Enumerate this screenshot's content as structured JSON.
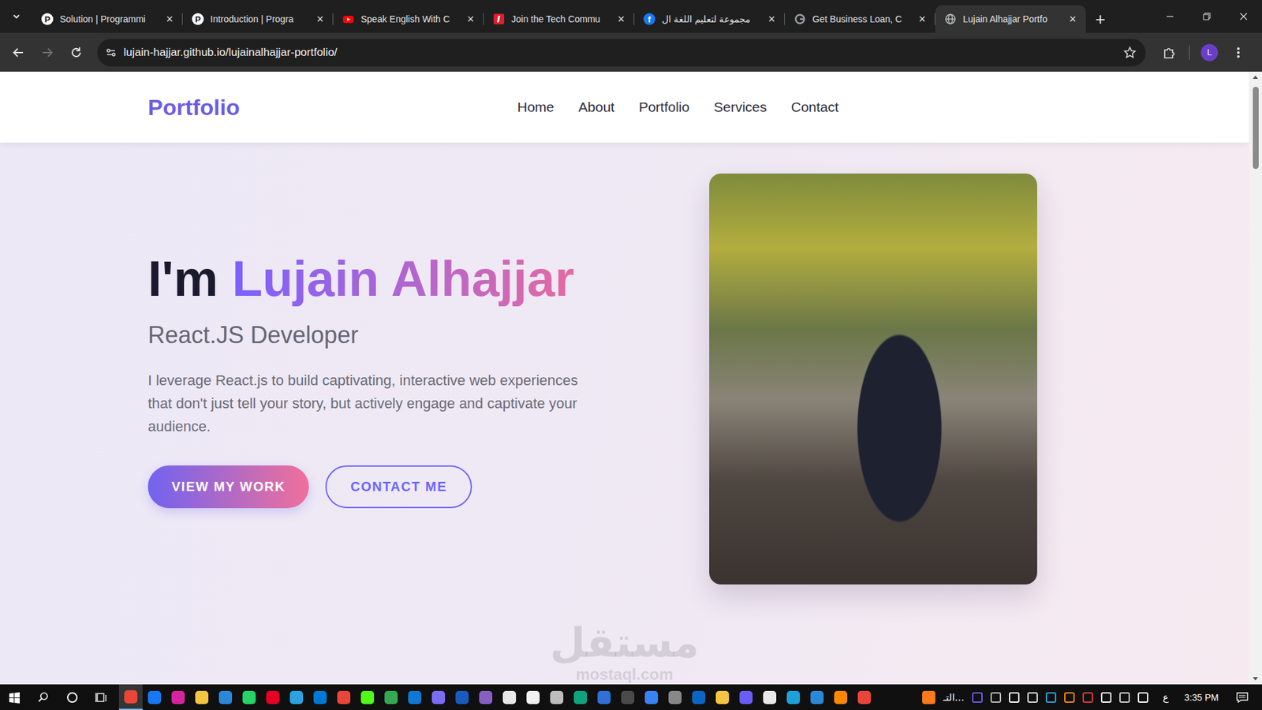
{
  "browser": {
    "tabs": [
      {
        "label": "Solution | Programmi",
        "selected": false,
        "favicon": "programiz",
        "favicon_text": "P"
      },
      {
        "label": "Introduction | Progra",
        "selected": false,
        "favicon": "programiz",
        "favicon_text": "P"
      },
      {
        "label": "Speak English With C",
        "selected": false,
        "favicon": "youtube"
      },
      {
        "label": "Join the Tech Commu",
        "selected": false,
        "favicon": "dev"
      },
      {
        "label": "مجموعة لتعليم اللغة ال",
        "selected": false,
        "favicon": "facebook",
        "favicon_text": "f"
      },
      {
        "label": "Get Business Loan, C",
        "selected": false,
        "favicon": "google"
      },
      {
        "label": "Lujain Alhajjar Portfo",
        "selected": true,
        "favicon": "globe"
      }
    ],
    "tab_close": "×",
    "new_tab": "+",
    "url": "lujain-hajjar.github.io/lujainalhajjar-portfolio/",
    "forward_disabled": true,
    "bookmarked": false,
    "profile": "L"
  },
  "navbar": {
    "logo": "Portfolio",
    "links": [
      {
        "label": "Home"
      },
      {
        "label": "About"
      },
      {
        "label": "Portfolio"
      },
      {
        "label": "Services"
      },
      {
        "label": "Contact"
      }
    ]
  },
  "hero": {
    "greeting": "I'm",
    "name": "Lujain Alhajjar",
    "role": "React.JS Developer",
    "description": "I leverage React.js to build captivating, interactive web experiences that don't just tell your story, but actively engage and captivate your audience.",
    "buttons": [
      {
        "label": "VIEW MY WORK",
        "kind": "filled"
      },
      {
        "label": "CONTACT ME",
        "kind": "outline"
      }
    ]
  },
  "scrollbar": {
    "level": 0.14
  },
  "watermark": {
    "arabic": "مستقل",
    "latin": "mostaql.com"
  },
  "taskbar": {
    "apps": [
      {
        "color": "#e9453a",
        "active": true
      },
      {
        "color": "#1877f2",
        "active": false
      },
      {
        "color": "#d6249f",
        "active": false
      },
      {
        "color": "#f4c542",
        "active": false
      },
      {
        "color": "#2b88d8",
        "active": false
      },
      {
        "color": "#25d366",
        "active": false
      },
      {
        "color": "#e60023",
        "active": false
      },
      {
        "color": "#2aa3e0",
        "active": false
      },
      {
        "color": "#0078d4",
        "active": false
      },
      {
        "color": "#e9453a",
        "active": false
      },
      {
        "color": "#53fc18",
        "active": false
      },
      {
        "color": "#34a853",
        "active": false
      },
      {
        "color": "#0f78d4",
        "active": false
      },
      {
        "color": "#7b6cf6",
        "active": false
      },
      {
        "color": "#185abd",
        "active": false
      },
      {
        "color": "#865fc5",
        "active": false
      },
      {
        "color": "#e8e8e8",
        "active": false
      },
      {
        "color": "#f2f2f2",
        "active": false
      },
      {
        "color": "#bdbdbd",
        "active": false
      },
      {
        "color": "#10a37f",
        "active": false
      },
      {
        "color": "#2f6fd6",
        "active": false
      },
      {
        "color": "#4a4a4a",
        "active": false
      },
      {
        "color": "#3b82f6",
        "active": false
      },
      {
        "color": "#888888",
        "active": false
      },
      {
        "color": "#0a66c2",
        "active": false
      },
      {
        "color": "#f4c542",
        "active": false
      },
      {
        "color": "#6a5cf6",
        "active": false
      },
      {
        "color": "#e9e9e9",
        "active": false
      },
      {
        "color": "#1fa0d9",
        "active": false
      },
      {
        "color": "#2b88d8",
        "active": false
      },
      {
        "color": "#ff8800",
        "active": false
      },
      {
        "color": "#e9453a",
        "active": false
      }
    ],
    "tray_app": {
      "color": "#ff7a1a"
    },
    "tray_text": "التـ...",
    "tray_icons": [
      {
        "color": "#6a5cf6"
      },
      {
        "color": "#bbbbbb"
      },
      {
        "color": "#ffffff"
      },
      {
        "color": "#dddddd"
      },
      {
        "color": "#2aa3e0"
      },
      {
        "color": "#ff8800"
      },
      {
        "color": "#e33b3b"
      },
      {
        "color": "#ffffff"
      },
      {
        "color": "#cfcfcf"
      },
      {
        "color": "#ffffff"
      }
    ],
    "language": "ع",
    "time": "3:35 PM"
  }
}
